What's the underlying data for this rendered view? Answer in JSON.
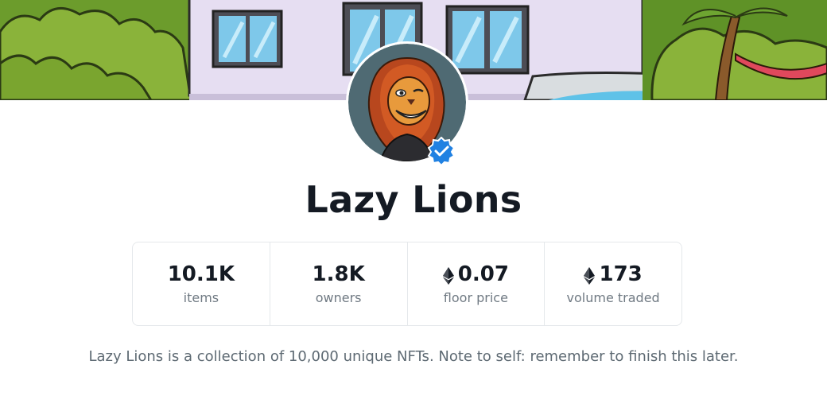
{
  "collection": {
    "name": "Lazy Lions",
    "verified": true,
    "description": "Lazy Lions is a collection of 10,000 unique NFTs. Note to self: remember to finish this later."
  },
  "stats": [
    {
      "value": "10.1K",
      "label": "items",
      "currency_icon": ""
    },
    {
      "value": "1.8K",
      "label": "owners",
      "currency_icon": ""
    },
    {
      "value": "0.07",
      "label": "floor price",
      "currency_icon": "ethereum-icon"
    },
    {
      "value": "173",
      "label": "volume traded",
      "currency_icon": "ethereum-icon"
    }
  ],
  "icons": {
    "banner": "cartoon-house-banner-image",
    "avatar": "lion-avatar-image",
    "badge": "verified-badge-icon"
  },
  "colors": {
    "text_primary": "#141a23",
    "text_secondary": "#707a83",
    "border": "#e5e8eb",
    "verified_blue": "#2081e2"
  }
}
